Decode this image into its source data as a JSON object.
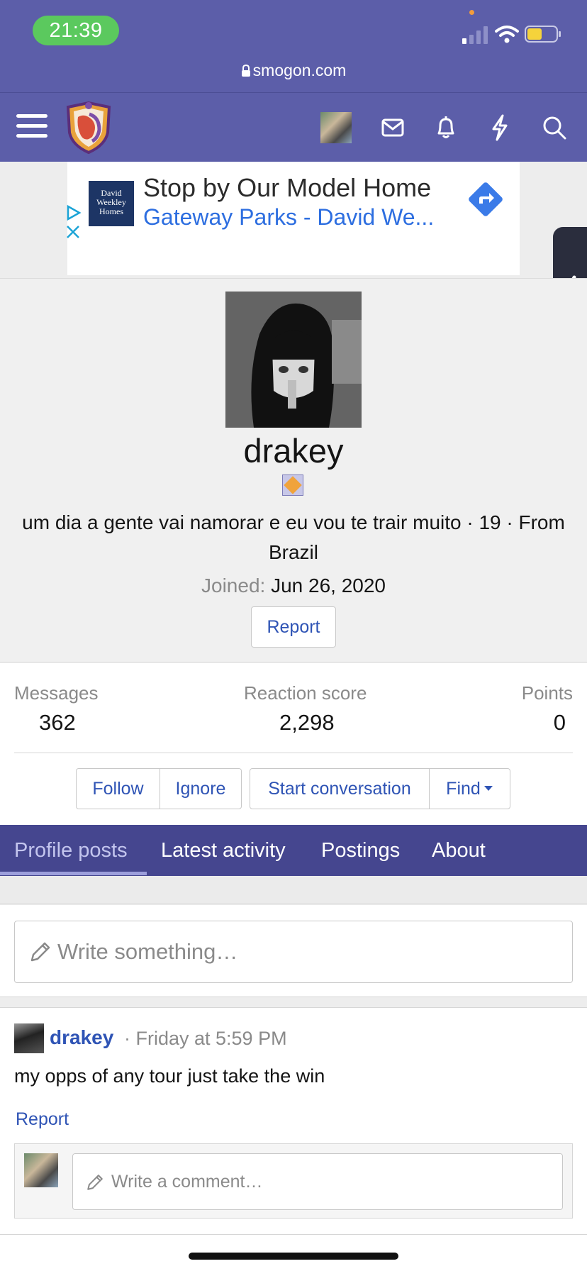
{
  "status_bar": {
    "time": "21:39",
    "url": "smogon.com"
  },
  "nav": {
    "icons": [
      "menu-icon",
      "site-logo",
      "user-avatar",
      "mail-icon",
      "bell-icon",
      "lightning-icon",
      "search-icon"
    ]
  },
  "ad": {
    "brand_line1": "David",
    "brand_line2": "Weekley",
    "brand_line3": "Homes",
    "headline": "Stop by Our Model Home",
    "subline": "Gateway Parks - David We..."
  },
  "profile": {
    "username": "drakey",
    "blurb": "um dia a gente vai namorar e eu vou te trair muito · 19 · From Brazil",
    "joined_label": "Joined:",
    "joined_date": "Jun 26, 2020",
    "report_label": "Report"
  },
  "stats": {
    "messages_label": "Messages",
    "messages_value": "362",
    "reaction_label": "Reaction score",
    "reaction_value": "2,298",
    "points_label": "Points",
    "points_value": "0"
  },
  "actions": {
    "follow": "Follow",
    "ignore": "Ignore",
    "start_conversation": "Start conversation",
    "find": "Find"
  },
  "tabs": [
    {
      "label": "Profile posts"
    },
    {
      "label": "Latest activity"
    },
    {
      "label": "Postings"
    },
    {
      "label": "About"
    }
  ],
  "composer": {
    "placeholder": "Write something…"
  },
  "post": {
    "author": "drakey",
    "meta": "· Friday at 5:59 PM",
    "body": "my opps of any tour just take the win",
    "report_label": "Report",
    "comment_placeholder": "Write a comment…"
  },
  "colors": {
    "nav_bg": "#5c5ea9",
    "tab_bg": "#45468f",
    "link": "#2f54b5",
    "time_pill": "#5bc95e"
  }
}
